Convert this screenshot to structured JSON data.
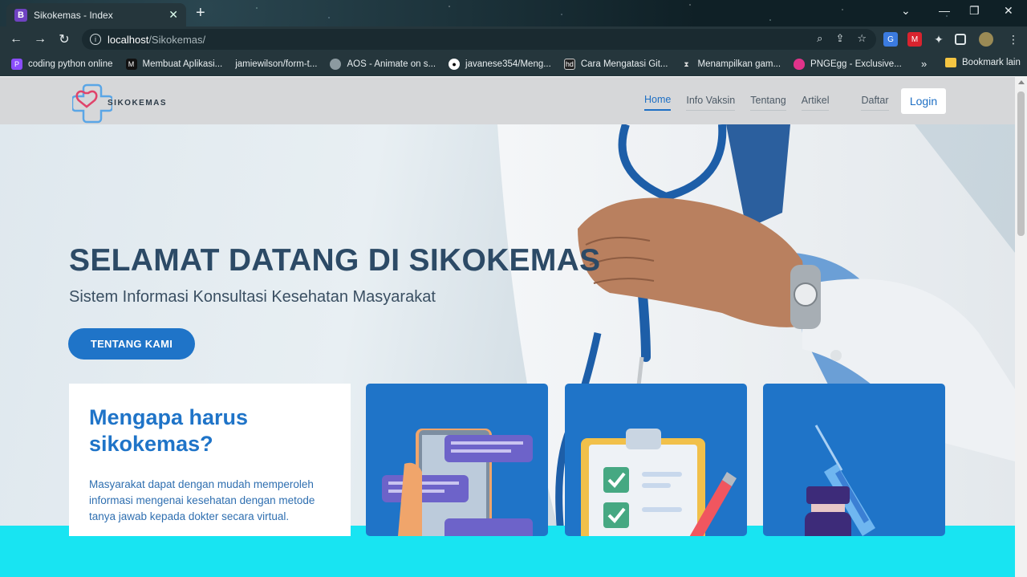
{
  "browser": {
    "tab_title": "Sikokemas - Index",
    "tab_favicon_letter": "B",
    "url_host": "localhost",
    "url_path": "/Sikokemas/",
    "bookmarks": [
      {
        "label": "coding python online",
        "icon": "purple-p-icon",
        "color": "#8a4dff"
      },
      {
        "label": "Membuat Aplikasi...",
        "icon": "dark-square-icon",
        "color": "#111111"
      },
      {
        "label": "jamiewilson/form-t...",
        "icon": "none",
        "color": "#25363c"
      },
      {
        "label": "AOS - Animate on s...",
        "icon": "globe-icon",
        "color": "#8c9aa0"
      },
      {
        "label": "javanese354/Meng...",
        "icon": "github-icon",
        "color": "#ffffff"
      },
      {
        "label": "Cara Mengatasi Git...",
        "icon": "hd-icon",
        "color": "#222222"
      },
      {
        "label": "Menampilkan gam...",
        "icon": "hourglass-icon",
        "color": "#25363c"
      },
      {
        "label": "PNGEgg - Exclusive...",
        "icon": "egg-icon",
        "color": "#e0338a"
      }
    ],
    "bookmarks_more": "»",
    "other_bookmarks": "Bookmark lain"
  },
  "nav": {
    "logo_text": "SIKOKEMAS",
    "links": [
      "Home",
      "Info Vaksin",
      "Tentang",
      "Artikel"
    ],
    "register": "Daftar",
    "login": "Login"
  },
  "hero": {
    "title": "SELAMAT DATANG DI SIKOKEMAS",
    "subtitle": "Sistem Informasi Konsultasi Kesehatan Masyarakat",
    "button": "TENTANG KAMI"
  },
  "why": {
    "title": "Mengapa harus sikokemas?",
    "text": "Masyarakat dapat dengan mudah memperoleh informasi mengenai kesehatan dengan metode tanya jawab kepada dokter secara virtual."
  },
  "colors": {
    "primary": "#1f74c8",
    "title": "#2c4a66",
    "navbar": "#d6d7d9",
    "accent_strip": "#18e4f2"
  }
}
